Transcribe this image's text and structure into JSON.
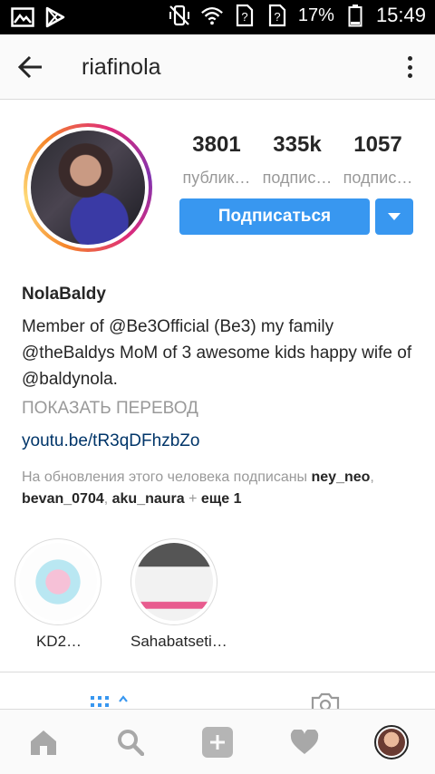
{
  "status_bar": {
    "battery": "17%",
    "time": "15:49",
    "icons": [
      "image-icon",
      "play-store-icon",
      "vibrate-off-icon",
      "wifi-icon",
      "sim-unknown-icon",
      "sim-unknown-icon",
      "battery-icon"
    ]
  },
  "header": {
    "username": "riafinola"
  },
  "profile": {
    "stats": [
      {
        "value": "3801",
        "label": "публик…"
      },
      {
        "value": "335k",
        "label": "подпис…"
      },
      {
        "value": "1057",
        "label": "подпис…"
      }
    ],
    "follow_label": "Подписаться",
    "full_name": "NolaBaldy",
    "bio": "Member of @Be3Official (Be3) my family @theBaldys MoM of 3 awesome kids happy wife of @baldynola.",
    "translate_label": "ПОКАЗАТЬ ПЕРЕВОД",
    "link": "youtu.be/tR3qDFhzbZo",
    "followed_by": {
      "prefix": "На обновления этого человека подписаны ",
      "user1": "ney_neo",
      "sep1": ", ",
      "user2": "bevan_0704",
      "sep2": ", ",
      "user3": "aku_naura",
      "plus": " + ",
      "more": "еще 1"
    }
  },
  "highlights": [
    {
      "label": "KD2…"
    },
    {
      "label": "Sahabatseti…"
    }
  ],
  "colors": {
    "accent": "#3897f0",
    "link": "#003569",
    "muted": "#999999",
    "text": "#262626"
  }
}
